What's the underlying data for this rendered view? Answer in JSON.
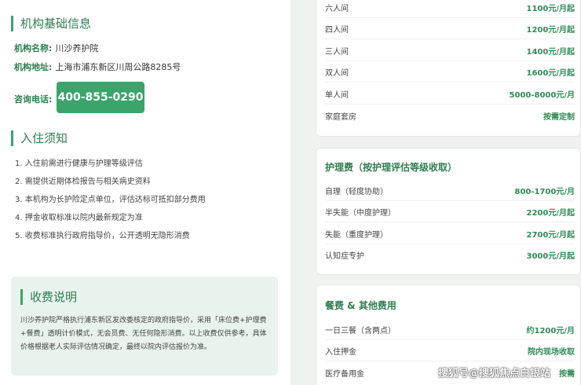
{
  "basic": {
    "title": "机构基础信息",
    "name_label": "机构名称:",
    "name_value": "川沙养护院",
    "addr_label": "机构地址:",
    "addr_value": "上海市浦东新区川周公路8285号",
    "phone_label": "咨询电话:",
    "phone_value": "400-855-0290"
  },
  "notes": {
    "title": "入住须知",
    "items": [
      "1. 入住前需进行健康与护理等级评估",
      "2. 需提供近期体检报告与相关病史资料",
      "3. 本机构为长护险定点单位，评估达标可抵扣部分费用",
      "4. 押金收取标准以院内最新规定为准",
      "5. 收费标准执行政府指导价，公开透明无隐形消费"
    ]
  },
  "fee_note": {
    "title": "收费说明",
    "text": "川沙养护院严格执行浦东新区发改委核定的政府指导价，采用「床位费+护理费+餐费」透明计价模式，无会员费、无任何隐形消费。以上收费仅供参考，具体价格根据老人实际评估情况确定，最终以院内评估报价为准。"
  },
  "room": {
    "rows": [
      {
        "name": "六人间",
        "price": "1100元/月起"
      },
      {
        "name": "四人间",
        "price": "1200元/月起"
      },
      {
        "name": "三人间",
        "price": "1400元/月起"
      },
      {
        "name": "双人间",
        "price": "1600元/月起"
      },
      {
        "name": "单人间",
        "price": "5000-8000元/月"
      },
      {
        "name": "家庭套房",
        "price": "按需定制"
      }
    ]
  },
  "care": {
    "title": "护理费（按护理评估等级收取）",
    "rows": [
      {
        "name": "自理（轻度协助）",
        "price": "800-1700元/月"
      },
      {
        "name": "半失能（中度护理）",
        "price": "2200元/月起"
      },
      {
        "name": "失能（重度护理）",
        "price": "2700元/月起"
      },
      {
        "name": "认知症专护",
        "price": "3000元/月起"
      }
    ]
  },
  "meal": {
    "title": "餐费 & 其他费用",
    "rows": [
      {
        "name": "一日三餐（含两点）",
        "price": "约1200元/月"
      },
      {
        "name": "入住押金",
        "price": "院内现场收取"
      },
      {
        "name": "医疗备用金",
        "price": "按需"
      }
    ]
  },
  "watermark": "搜狐号@搜狐焦点白银站"
}
